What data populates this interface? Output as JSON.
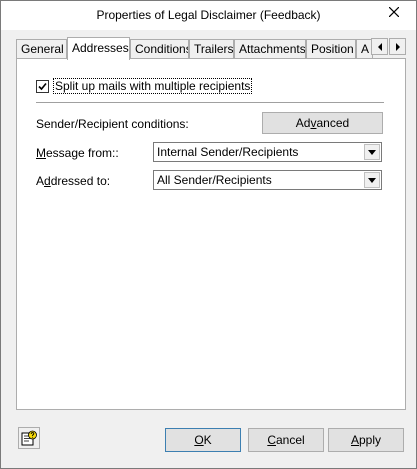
{
  "window": {
    "title": "Properties of Legal Disclaimer (Feedback)"
  },
  "tabs": [
    {
      "label": "General"
    },
    {
      "label": "Addresses"
    },
    {
      "label": "Conditions"
    },
    {
      "label": "Trailers"
    },
    {
      "label": "Attachments"
    },
    {
      "label": "Position"
    },
    {
      "label": "A"
    }
  ],
  "active_tab": "Addresses",
  "split_checkbox": {
    "label": "Split up mails with multiple recipients",
    "checked": true
  },
  "conditions": {
    "label": "Sender/Recipient conditions:",
    "button_label_pre": "Ad",
    "button_label_u": "v",
    "button_label_post": "anced"
  },
  "message_from": {
    "label_u": "M",
    "label_rest": "essage from::",
    "value": "Internal Sender/Recipients"
  },
  "addressed_to": {
    "label_pre": "A",
    "label_u": "d",
    "label_post": "dressed to:",
    "value": "All Sender/Recipients"
  },
  "footer": {
    "ok_u": "O",
    "ok_rest": "K",
    "cancel_u": "C",
    "cancel_rest": "ancel",
    "apply_u": "A",
    "apply_rest": "pply"
  },
  "icons": [
    "close-icon",
    "chevron-left-icon",
    "chevron-right-icon",
    "checkmark-icon",
    "dropdown-arrow-icon",
    "help-icon"
  ]
}
